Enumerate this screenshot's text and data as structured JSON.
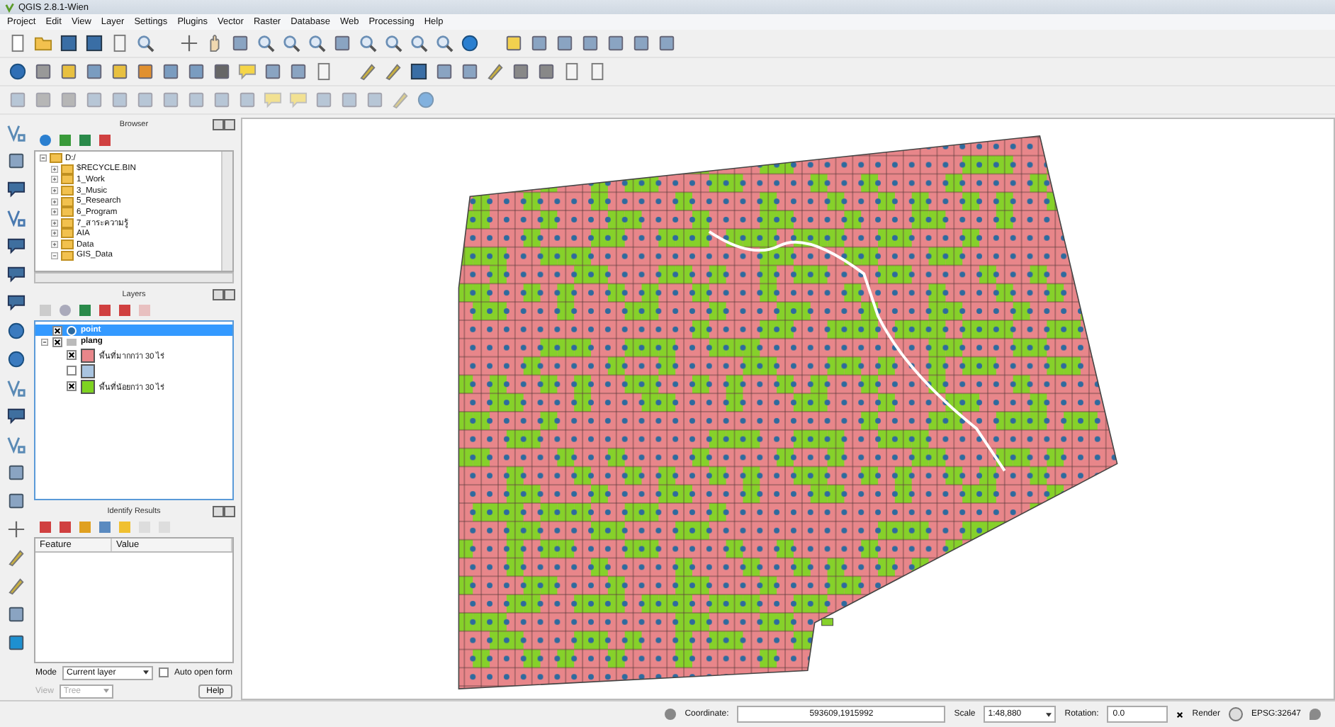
{
  "window": {
    "title": "QGIS 2.8.1-Wien"
  },
  "menu": [
    "Project",
    "Edit",
    "View",
    "Layer",
    "Settings",
    "Plugins",
    "Vector",
    "Raster",
    "Database",
    "Web",
    "Processing",
    "Help"
  ],
  "browser": {
    "title": "Browser",
    "items": [
      {
        "label": "D:/",
        "expanded": true,
        "children": [
          {
            "label": "$RECYCLE.BIN",
            "expanded": false
          },
          {
            "label": "1_Work",
            "expanded": false
          },
          {
            "label": "3_Music",
            "expanded": false
          },
          {
            "label": "5_Research",
            "expanded": false
          },
          {
            "label": "6_Program",
            "expanded": false
          },
          {
            "label": "7_สาระความรู้",
            "expanded": false
          },
          {
            "label": "AIA",
            "expanded": false
          },
          {
            "label": "Data",
            "expanded": false
          },
          {
            "label": "GIS_Data",
            "expanded": true
          }
        ]
      }
    ]
  },
  "layers": {
    "title": "Layers",
    "items": [
      {
        "label": "point",
        "kind": "point",
        "checked": true,
        "selected": true
      },
      {
        "label": "plang",
        "kind": "polygon",
        "checked": true,
        "selected": false,
        "expanded": true,
        "children": [
          {
            "label": "พื้นที่มากกว่า 30 ไร่",
            "checked": true,
            "color": "#e8868a"
          },
          {
            "checked": false,
            "color": "#a9c4e0"
          },
          {
            "label": "พื้นที่น้อยกว่า 30 ไร่",
            "checked": true,
            "color": "#7ed321"
          }
        ]
      }
    ]
  },
  "identify": {
    "title": "Identify Results",
    "columns": [
      "Feature",
      "Value"
    ],
    "mode_label": "Mode",
    "mode": "Current layer",
    "auto_open": {
      "label": "Auto open form",
      "checked": false
    },
    "view_label": "View",
    "view": "Tree",
    "view_disabled": true,
    "help": "Help"
  },
  "status_bar": {
    "coordinate_label": "Coordinate:",
    "coordinate": "593609,1915992",
    "scale_label": "Scale",
    "scale": "1:48,880",
    "rotation_label": "Rotation:",
    "rotation": "0.0",
    "render": {
      "label": "Render",
      "checked": true
    },
    "crs": "EPSG:32647"
  }
}
